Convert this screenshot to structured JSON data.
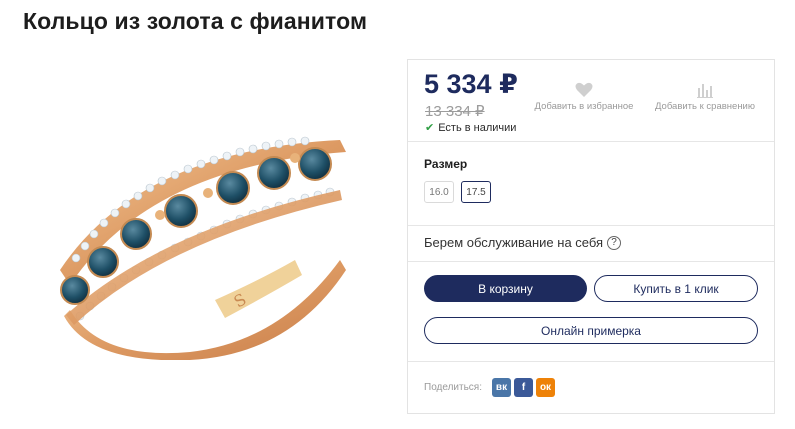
{
  "product": {
    "title": "Кольцо из золота с фианитом",
    "image_alt": "ring"
  },
  "pricing": {
    "price": "5 334 ₽",
    "old_price": "13 334 ₽",
    "stock": "Есть в наличии"
  },
  "actions": {
    "favorite_label": "Добавить в избранное",
    "compare_label": "Добавить к сравнению"
  },
  "size": {
    "title": "Размер",
    "options": [
      "16.0",
      "17.5"
    ],
    "selected": "17.5"
  },
  "service": {
    "text": "Берем обслуживание на себя",
    "help": "?"
  },
  "buttons": {
    "cart": "В корзину",
    "one_click": "Купить в 1 клик",
    "fitting": "Онлайн примерка"
  },
  "share": {
    "label": "Поделиться:",
    "networks": [
      {
        "name": "vk",
        "glyph": "вк",
        "color": "#4a76a8"
      },
      {
        "name": "facebook",
        "glyph": "f",
        "color": "#3b5998"
      },
      {
        "name": "odnoklassniki",
        "glyph": "ок",
        "color": "#ee8208"
      }
    ]
  },
  "colors": {
    "brand": "#1e2b5e",
    "stock": "#2f9e44",
    "gold": "#e2a06a",
    "stone": "#1e4f66"
  }
}
